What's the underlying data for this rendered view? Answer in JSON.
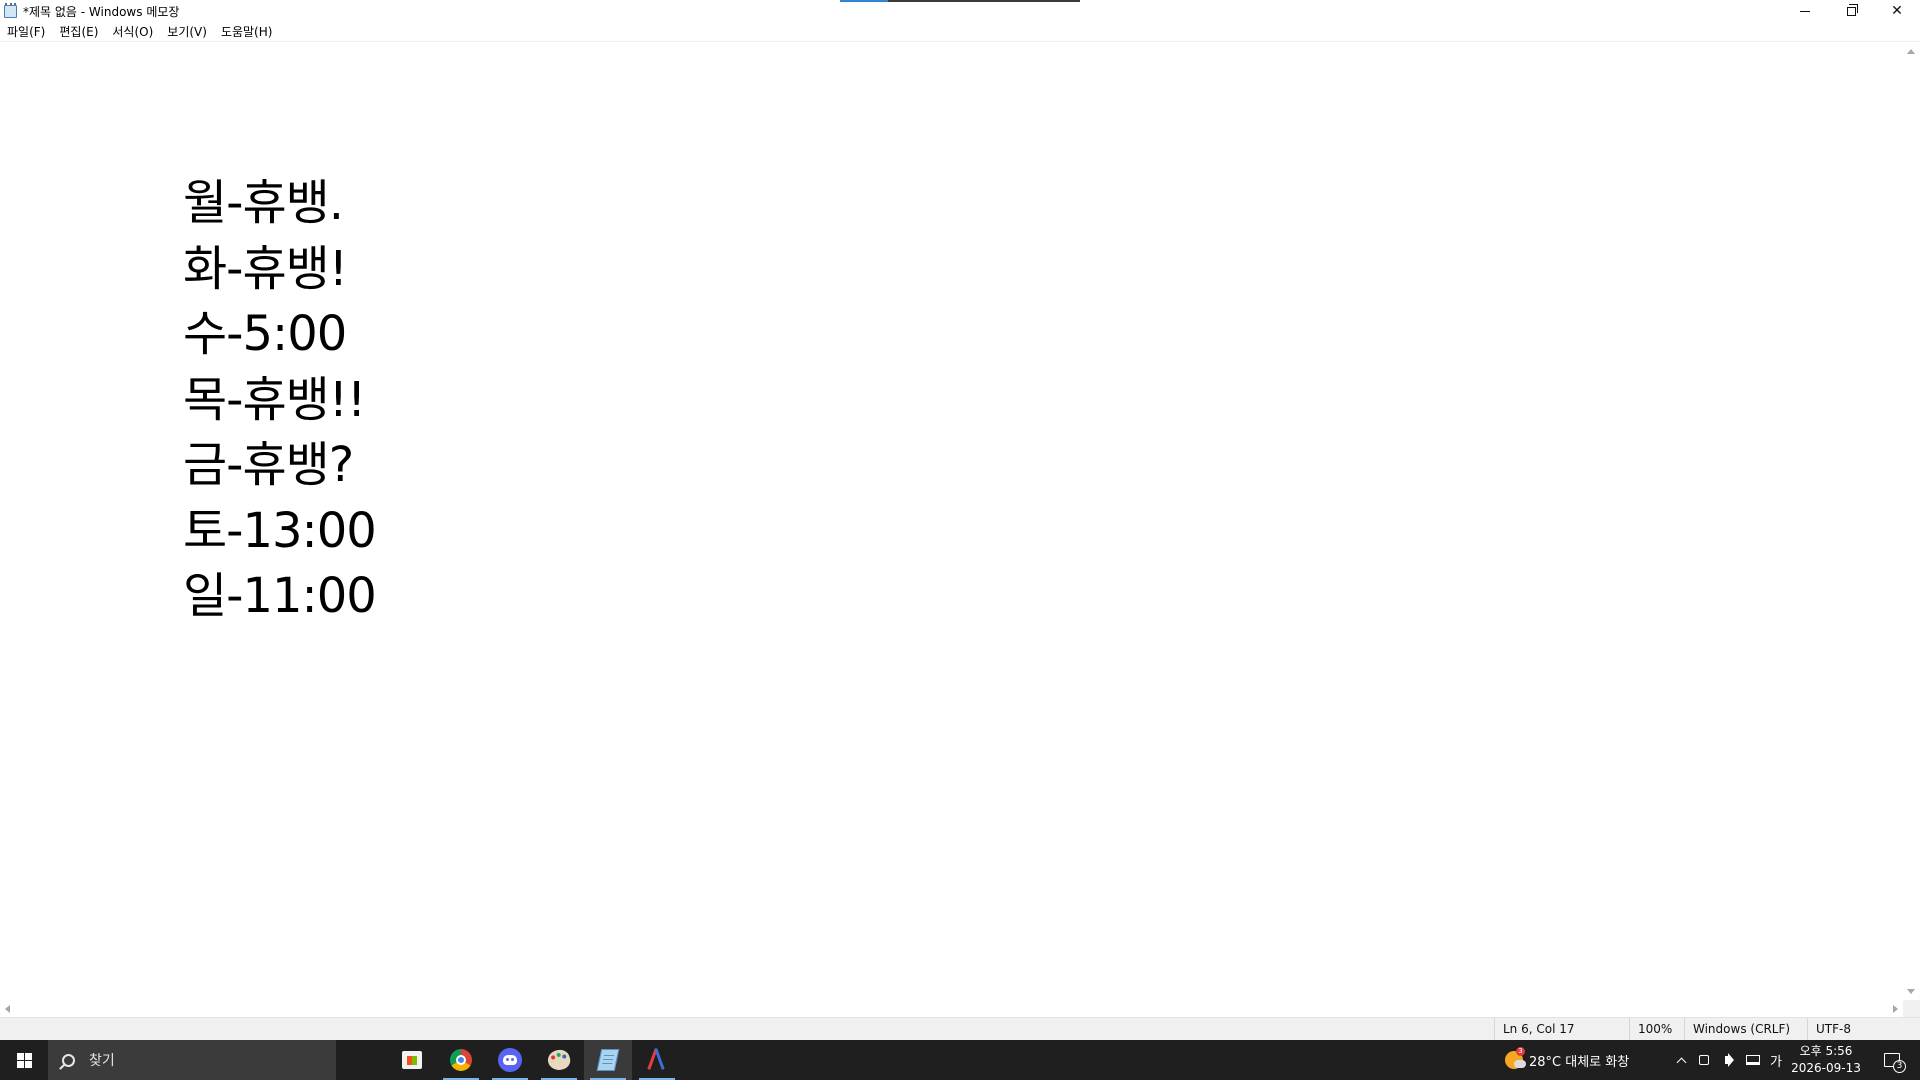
{
  "window": {
    "title": "*제목 없음 - Windows 메모장"
  },
  "menu": [
    "파일(F)",
    "편집(E)",
    "서식(O)",
    "보기(V)",
    "도움말(H)"
  ],
  "editor": {
    "lines": [
      "월-휴뱅.",
      "화-휴뱅!",
      "수-5:00",
      "목-휴뱅!!",
      "금-휴뱅?",
      "토-13:00",
      "일-11:00"
    ]
  },
  "status": {
    "position": "Ln 6, Col 17",
    "zoom": "100%",
    "line_ending": "Windows (CRLF)",
    "encoding": "UTF-8"
  },
  "taskbar": {
    "search_placeholder": "찾기",
    "apps": [
      "store-icon",
      "chrome-icon",
      "discord-icon",
      "paint-icon",
      "notepad-icon",
      "snip-icon"
    ],
    "active_app": "notepad-icon",
    "weather": {
      "text": "28°C  대체로 화창",
      "badge": "3"
    },
    "ime": "가",
    "clock": {
      "time": "오후 5:56",
      "date": "2026-09-13"
    },
    "notifications": "3"
  },
  "colors": {
    "taskbar_bg": "#1f1f1f",
    "search_bg": "#3b3b3b",
    "accent": "#7fb3e0",
    "statusbar_bg": "#f0f0f0"
  }
}
